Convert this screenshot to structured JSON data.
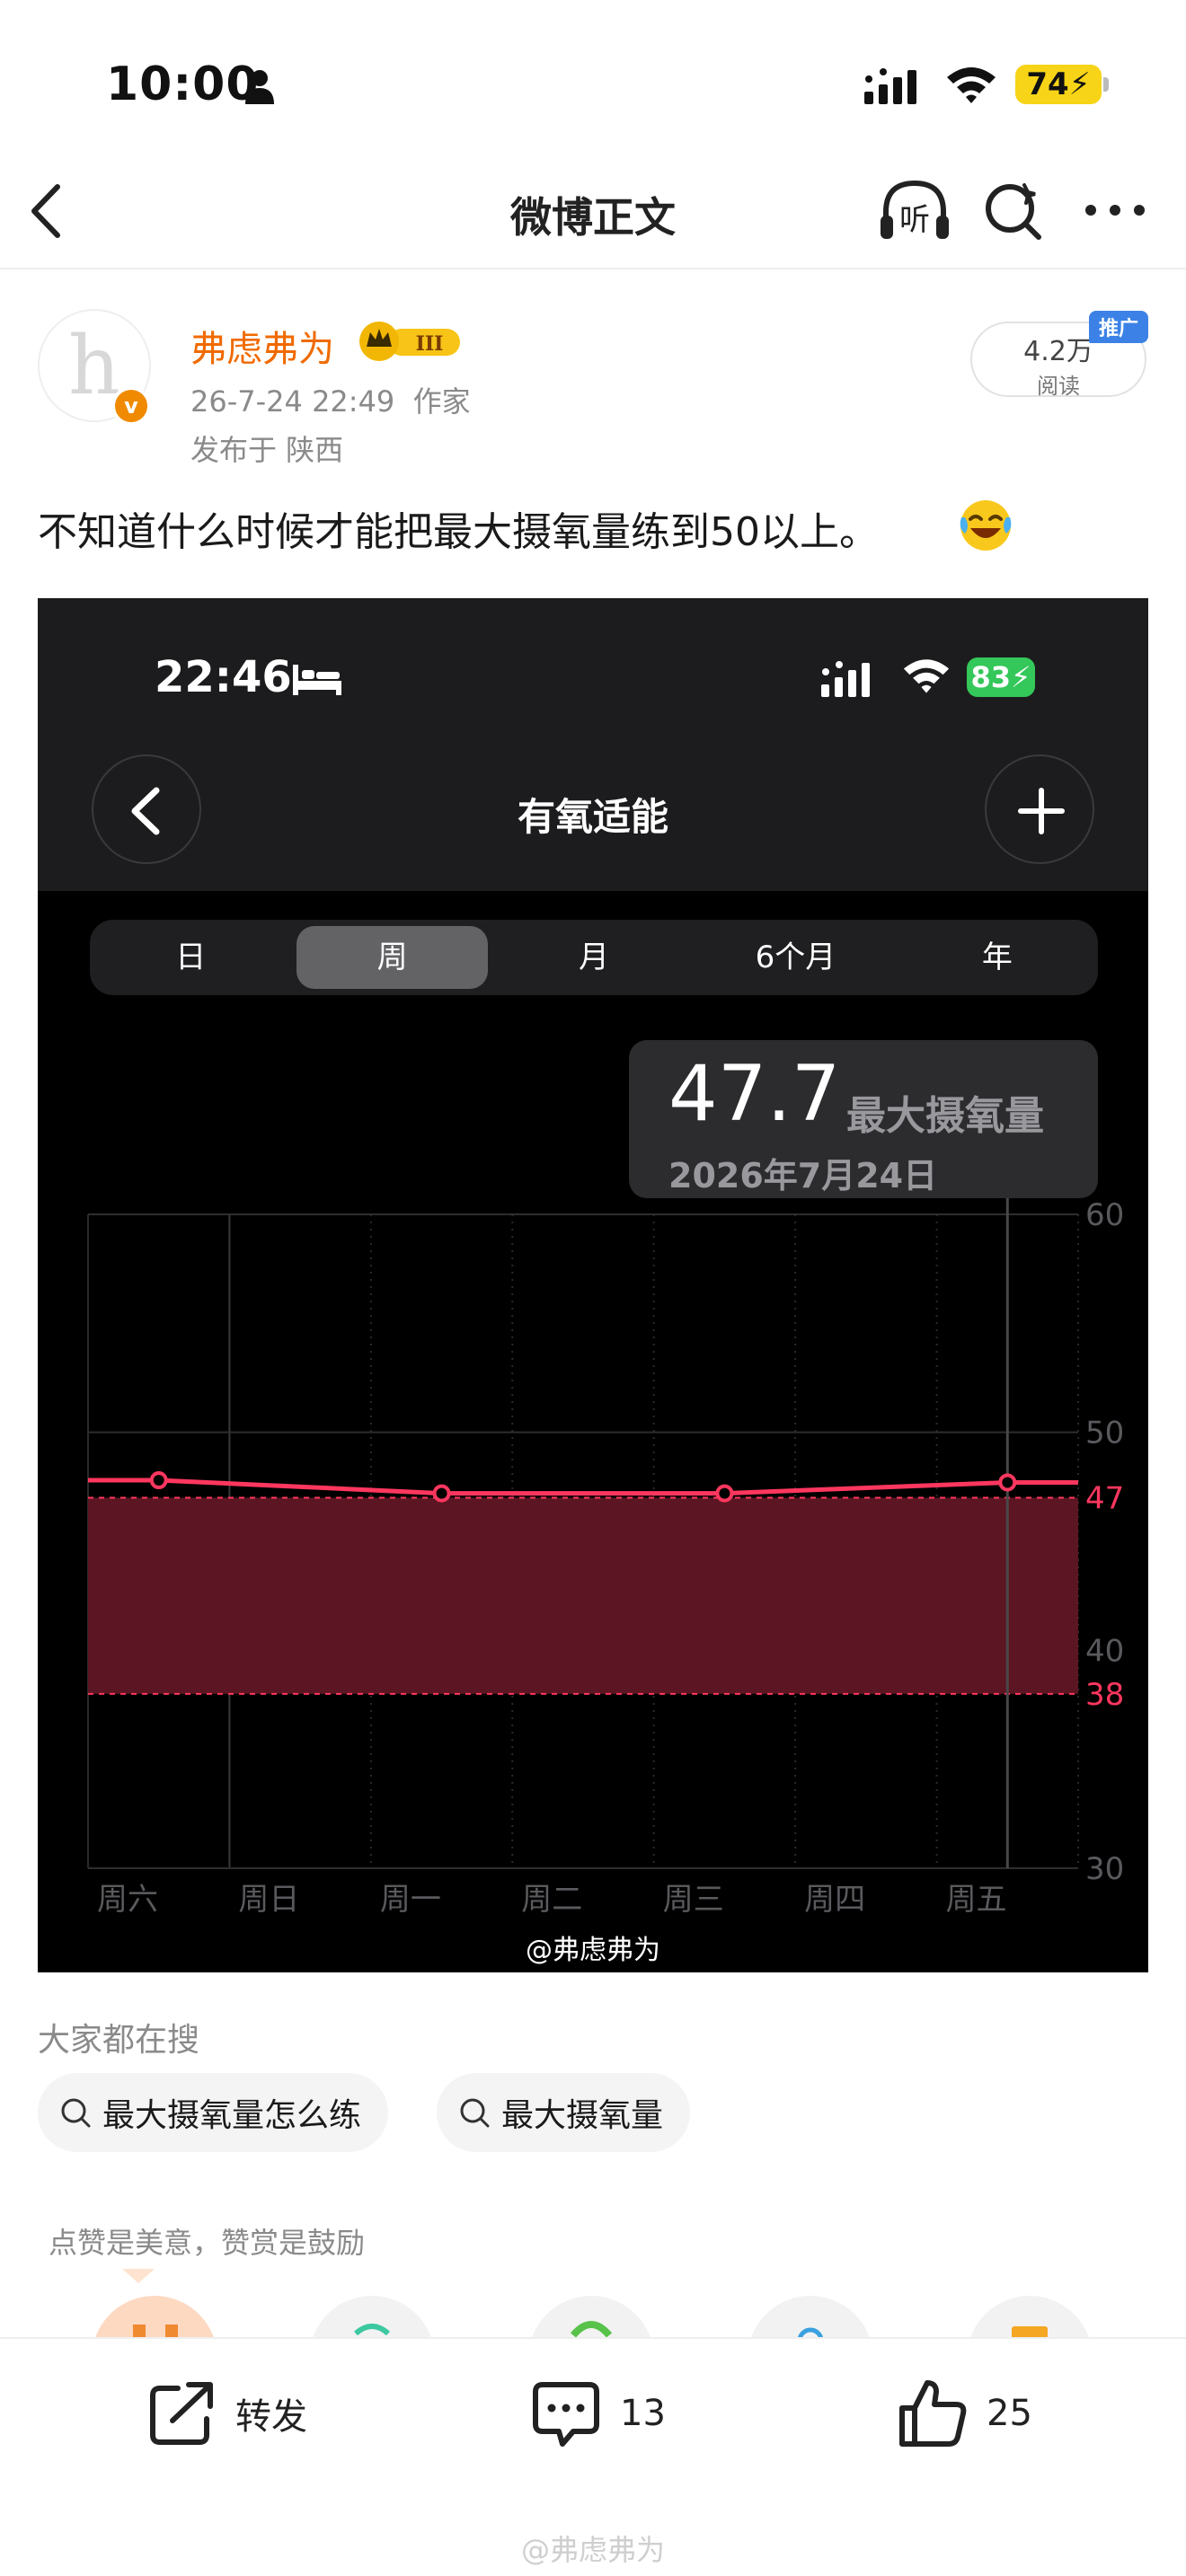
{
  "status_bar": {
    "time": "10:00",
    "battery": "74",
    "icons": [
      "person-icon",
      "signal-icon",
      "wifi-icon",
      "battery-icon"
    ]
  },
  "nav": {
    "title": "微博正文",
    "icons": [
      "back-icon",
      "listen-icon",
      "search-icon",
      "more-icon"
    ],
    "listen_label": "听"
  },
  "post": {
    "author": "弗虑弗为",
    "member_level": "III",
    "meta": "26-7-24 22:49  作家",
    "location": "发布于 陕西",
    "reads_count": "4.2万",
    "reads_label": "阅读",
    "promo_tag": "推广",
    "text": "不知道什么时候才能把最大摄氧量练到50以上。",
    "emoji": "laughing-tears-emoji",
    "avatar_letter": "h",
    "verified_mark": "v"
  },
  "screenshot": {
    "status_time": "22:46",
    "status_battery": "83",
    "title": "有氧适能",
    "segments": [
      {
        "label": "日",
        "active": false
      },
      {
        "label": "周",
        "active": true
      },
      {
        "label": "月",
        "active": false
      },
      {
        "label": "6个月",
        "active": false
      },
      {
        "label": "年",
        "active": false
      }
    ],
    "tooltip": {
      "value": "47.7",
      "label": "最大摄氧量",
      "date": "2026年7月24日"
    },
    "watermark": "@弗虑弗为"
  },
  "chart_data": {
    "type": "line",
    "categories": [
      "周六",
      "周日",
      "周一",
      "周二",
      "周三",
      "周四",
      "周五"
    ],
    "series": [
      {
        "name": "最大摄氧量",
        "points": [
          {
            "x": "周六",
            "y": 47.8
          },
          {
            "x": "周一",
            "y": 47.2
          },
          {
            "x": "周三",
            "y": 47.2
          },
          {
            "x": "周五",
            "y": 47.7
          }
        ]
      }
    ],
    "range_band": {
      "low": 38,
      "high": 47
    },
    "range_labels": [
      "47",
      "38"
    ],
    "y_ticks": [
      "60",
      "50",
      "40",
      "30"
    ],
    "ylim": [
      30,
      60
    ],
    "line_color": "#ff375f",
    "band_color": "#5c1522",
    "grid": true
  },
  "search": {
    "heading": "大家都在搜",
    "chips": [
      "最大摄氧量怎么练",
      "最大摄氧量"
    ]
  },
  "reward_text": "点赞是美意，赞赏是鼓励",
  "actions": {
    "repost": "转发",
    "comments": "13",
    "likes": "25"
  },
  "footer_watermark": "@弗虑弗为",
  "colors": {
    "author_name": "#f06a00",
    "accent_yellow": "#f7d417",
    "promo_blue": "#3c82e6",
    "chart_line": "#ff375f"
  }
}
